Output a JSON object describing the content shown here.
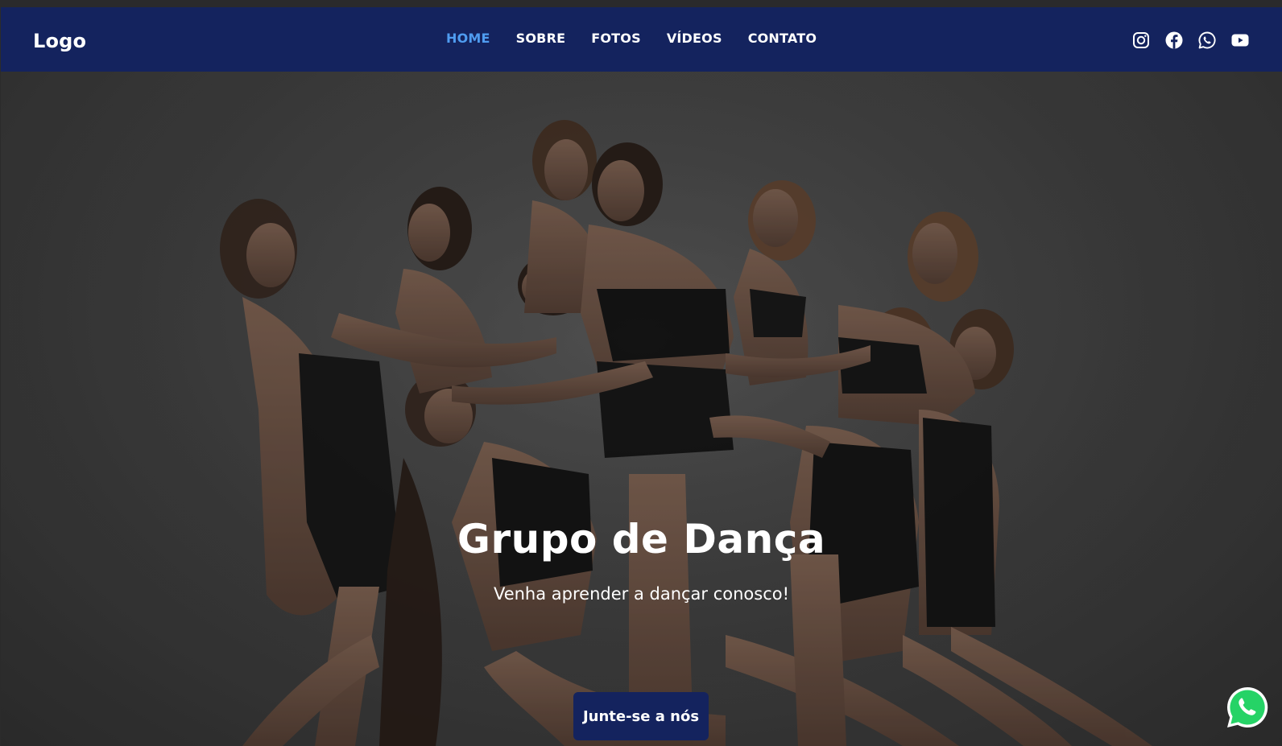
{
  "header": {
    "logo": "Logo",
    "nav": [
      {
        "label": "HOME",
        "active": true
      },
      {
        "label": "SOBRE",
        "active": false
      },
      {
        "label": "FOTOS",
        "active": false
      },
      {
        "label": "VÍDEOS",
        "active": false
      },
      {
        "label": "CONTATO",
        "active": false
      }
    ],
    "social_icons": [
      "instagram-icon",
      "facebook-icon",
      "whatsapp-icon",
      "youtube-icon"
    ]
  },
  "hero": {
    "title": "Grupo de Dança",
    "subtitle": "Venha aprender a dançar conosco!",
    "cta_label": "Junte-se a nós",
    "background_image": "dance group photo"
  },
  "floating": {
    "whatsapp_icon": "whatsapp-icon"
  },
  "colors": {
    "navbar_bg": "#14235e",
    "nav_active": "#4f9cf0",
    "button_bg": "#14235e",
    "whatsapp_green": "#25d366"
  }
}
